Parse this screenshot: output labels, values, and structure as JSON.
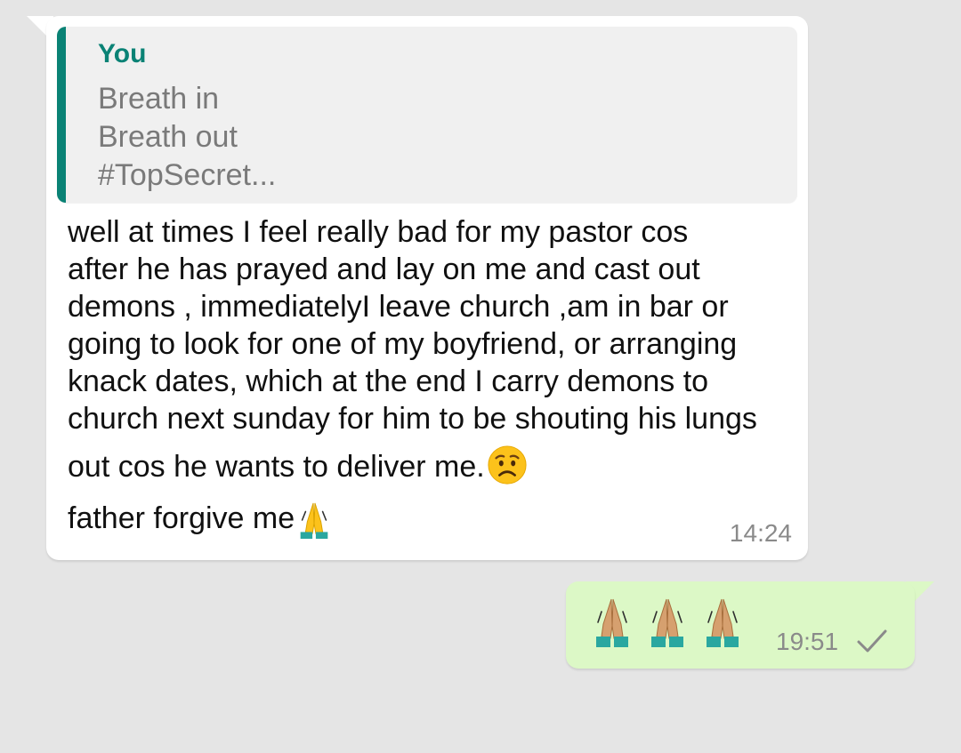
{
  "incoming": {
    "quote": {
      "author": "You",
      "lines": [
        "Breath in",
        "Breath out",
        "#TopSecret..."
      ]
    },
    "lines": [
      "well at times I feel really bad for my pastor cos",
      "after he has prayed and lay on me and cast out",
      "demons , immediatelyI leave church ,am in bar or",
      "going to look for one of my boyfriend, or arranging",
      "knack dates, which at the end I carry demons to",
      "church next sunday for him to be shouting his lungs",
      "out cos he wants to deliver me."
    ],
    "closing": "father forgive me",
    "time": "14:24",
    "icons": {
      "after_last_line": "worried-face-emoji",
      "after_closing": "folded-hands-emoji"
    }
  },
  "outgoing": {
    "emojis": [
      "folded-hands-emoji",
      "folded-hands-emoji",
      "folded-hands-emoji"
    ],
    "time": "19:51",
    "status_icon": "single-check-icon"
  },
  "colors": {
    "background": "#e5e5e5",
    "incoming_bubble": "#ffffff",
    "outgoing_bubble": "#dcf8c6",
    "quote_accent": "#0a8275",
    "quote_background": "#f0f0f0",
    "timestamp": "#8a8a8a"
  }
}
